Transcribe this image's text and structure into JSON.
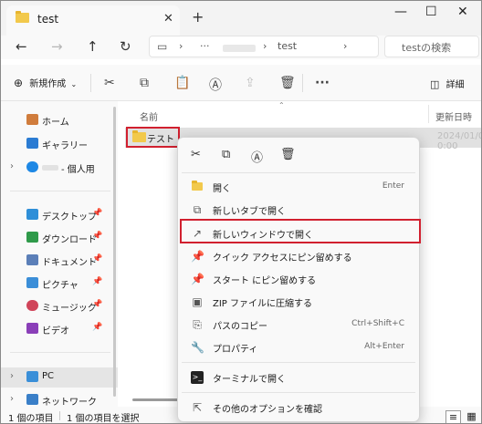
{
  "tab": {
    "title": "test",
    "close": "✕",
    "new": "+"
  },
  "window_controls": {
    "minimize": "—",
    "maximize": "☐",
    "close": "✕"
  },
  "address": {
    "more": "···",
    "path": "test",
    "separator": "›",
    "search_placeholder": "testの検索"
  },
  "commandbar": {
    "new_label": "新規作成",
    "details_label": "詳細",
    "more": "···"
  },
  "navpane": {
    "items": [
      {
        "label": "ホーム",
        "color": "#d07c3c"
      },
      {
        "label": "ギャラリー",
        "color": "#2b7cd3"
      },
      {
        "label": "- 個人用",
        "color": "#1e88e5"
      },
      {
        "label": "デスクトップ",
        "color": "#2f8fd8"
      },
      {
        "label": "ダウンロード",
        "color": "#2f9a4a"
      },
      {
        "label": "ドキュメント",
        "color": "#5b7fb8"
      },
      {
        "label": "ピクチャ",
        "color": "#3b8ed8"
      },
      {
        "label": "ミュージック",
        "color": "#d0455a"
      },
      {
        "label": "ビデオ",
        "color": "#8a3fb8"
      },
      {
        "label": "PC",
        "color": "#3a8fd8"
      },
      {
        "label": "ネットワーク",
        "color": "#3a7fc8"
      }
    ],
    "pin": "📌"
  },
  "content": {
    "col_name": "名前",
    "col_date": "更新日時",
    "file": {
      "name": "テスト",
      "date": "2024/01/01 0:00"
    }
  },
  "context_menu": {
    "items": [
      {
        "label": "開く",
        "shortcut": "Enter"
      },
      {
        "label": "新しいタブで開く",
        "shortcut": ""
      },
      {
        "label": "新しいウィンドウで開く",
        "shortcut": ""
      },
      {
        "label": "クイック アクセスにピン留めする",
        "shortcut": ""
      },
      {
        "label": "スタート にピン留めする",
        "shortcut": ""
      },
      {
        "label": "ZIP ファイルに圧縮する",
        "shortcut": ""
      },
      {
        "label": "パスのコピー",
        "shortcut": "Ctrl+Shift+C"
      },
      {
        "label": "プロパティ",
        "shortcut": "Alt+Enter"
      },
      {
        "label": "ターミナルで開く",
        "shortcut": ""
      },
      {
        "label": "その他のオプションを確認",
        "shortcut": ""
      }
    ]
  },
  "status": {
    "count": "1 個の項目",
    "selected": "1 個の項目を選択"
  },
  "colors": {
    "highlight": "#d1202f",
    "selection": "#e1e1e1"
  }
}
